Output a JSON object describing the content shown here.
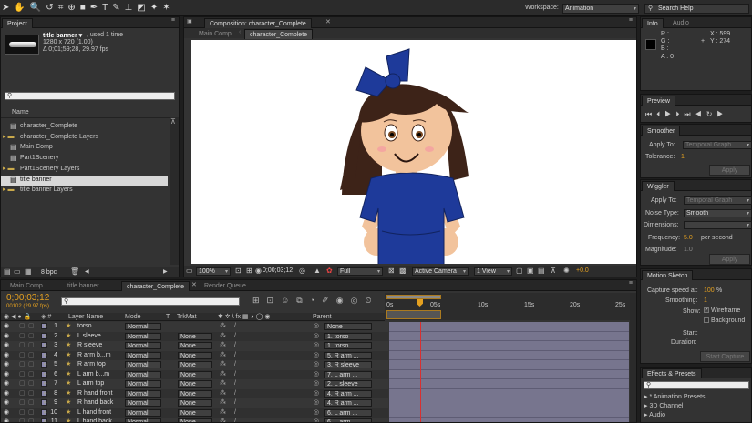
{
  "toolbar": {
    "workspace_label": "Workspace:",
    "workspace_value": "Animation",
    "search_placeholder": "Search Help"
  },
  "project": {
    "tab": "Project",
    "item_name": "title banner ▾",
    "item_used": ", used 1 time",
    "item_size": "1280 x 720 (1.00)",
    "item_duration": "Δ 0;01;59;28, 29.97 fps",
    "column_name": "Name",
    "items": [
      {
        "label": "character_Complete",
        "type": "comp"
      },
      {
        "label": "character_Complete Layers",
        "type": "folder"
      },
      {
        "label": "Main Comp",
        "type": "comp"
      },
      {
        "label": "Part1Scenery",
        "type": "comp"
      },
      {
        "label": "Part1Scenery Layers",
        "type": "folder"
      },
      {
        "label": "title banner",
        "type": "comp"
      },
      {
        "label": "title banner Layers",
        "type": "folder"
      }
    ],
    "bpc": "8 bpc"
  },
  "composition": {
    "tab": "Composition: character_Complete",
    "subtabs": [
      "Main Comp",
      "character_Complete"
    ],
    "zoom": "100%",
    "timecode": "0;00;03;12",
    "resolution": "Full",
    "camera": "Active Camera",
    "view": "1 View",
    "exposure": "+0.0"
  },
  "info": {
    "tabs": [
      "Info",
      "Audio"
    ],
    "r": "R :",
    "g": "G :",
    "b": "B :",
    "a": "A : 0",
    "x": "X : 599",
    "y": "Y : 274"
  },
  "preview": {
    "tab": "Preview"
  },
  "smoother": {
    "tab": "Smoother",
    "apply_label": "Apply To:",
    "apply_value": "Temporal Graph",
    "tolerance_label": "Tolerance:",
    "tolerance_value": "1",
    "apply_button": "Apply"
  },
  "wiggler": {
    "tab": "Wiggler",
    "apply_label": "Apply To:",
    "apply_value": "Temporal Graph",
    "noise_label": "Noise Type:",
    "noise_value": "Smooth",
    "dimensions_label": "Dimensions:",
    "frequency_label": "Frequency:",
    "frequency_value": "5.0",
    "frequency_unit": "per second",
    "magnitude_label": "Magnitude:",
    "magnitude_value": "1.0",
    "apply_button": "Apply"
  },
  "motion_sketch": {
    "tab": "Motion Sketch",
    "capture_label": "Capture speed at:",
    "capture_value": "100",
    "capture_unit": "%",
    "smoothing_label": "Smoothing:",
    "smoothing_value": "1",
    "show_label": "Show:",
    "wireframe": "Wireframe",
    "background": "Background",
    "start_label": "Start:",
    "duration_label": "Duration:",
    "start_button": "Start Capture"
  },
  "effects": {
    "tab": "Effects & Presets",
    "items": [
      "* Animation Presets",
      "3D Channel",
      "Audio"
    ]
  },
  "timeline": {
    "tabs": [
      "Main Comp",
      "title banner",
      "character_Complete",
      "Render Queue"
    ],
    "timecode": "0;00;03;12",
    "frame_info": "00102 (29.97 fps)",
    "columns": {
      "layer_name": "Layer Name",
      "mode": "Mode",
      "t": "T",
      "trkmat": "TrkMat",
      "parent": "Parent"
    },
    "ruler": [
      "0s",
      "05s",
      "10s",
      "15s",
      "20s",
      "25s"
    ],
    "layers": [
      {
        "num": "1",
        "name": "torso",
        "mode": "Normal",
        "trkmat": "",
        "parent": "None"
      },
      {
        "num": "2",
        "name": "L sleeve",
        "mode": "Normal",
        "trkmat": "None",
        "parent": "1. torso"
      },
      {
        "num": "3",
        "name": "R sleeve",
        "mode": "Normal",
        "trkmat": "None",
        "parent": "1. torso"
      },
      {
        "num": "4",
        "name": "R arm b...m",
        "mode": "Normal",
        "trkmat": "None",
        "parent": "5. R arm ..."
      },
      {
        "num": "5",
        "name": "R arm top",
        "mode": "Normal",
        "trkmat": "None",
        "parent": "3. R sleeve"
      },
      {
        "num": "6",
        "name": "L arm b...m",
        "mode": "Normal",
        "trkmat": "None",
        "parent": "7. L arm ..."
      },
      {
        "num": "7",
        "name": "L arm top",
        "mode": "Normal",
        "trkmat": "None",
        "parent": "2. L sleeve"
      },
      {
        "num": "8",
        "name": "R hand front",
        "mode": "Normal",
        "trkmat": "None",
        "parent": "4. R arm ..."
      },
      {
        "num": "9",
        "name": "R hand back",
        "mode": "Normal",
        "trkmat": "None",
        "parent": "4. R arm ..."
      },
      {
        "num": "10",
        "name": "L hand front",
        "mode": "Normal",
        "trkmat": "None",
        "parent": "6. L arm ..."
      },
      {
        "num": "11",
        "name": "L hand back",
        "mode": "Normal",
        "trkmat": "None",
        "parent": "6. L arm ..."
      }
    ]
  },
  "colors": {
    "accent": "#e4a020",
    "layer_bar": "#77758e",
    "panel": "#333333",
    "dress": "#1e3a9a",
    "hair": "#3d2318",
    "skin": "#f2c39c"
  }
}
